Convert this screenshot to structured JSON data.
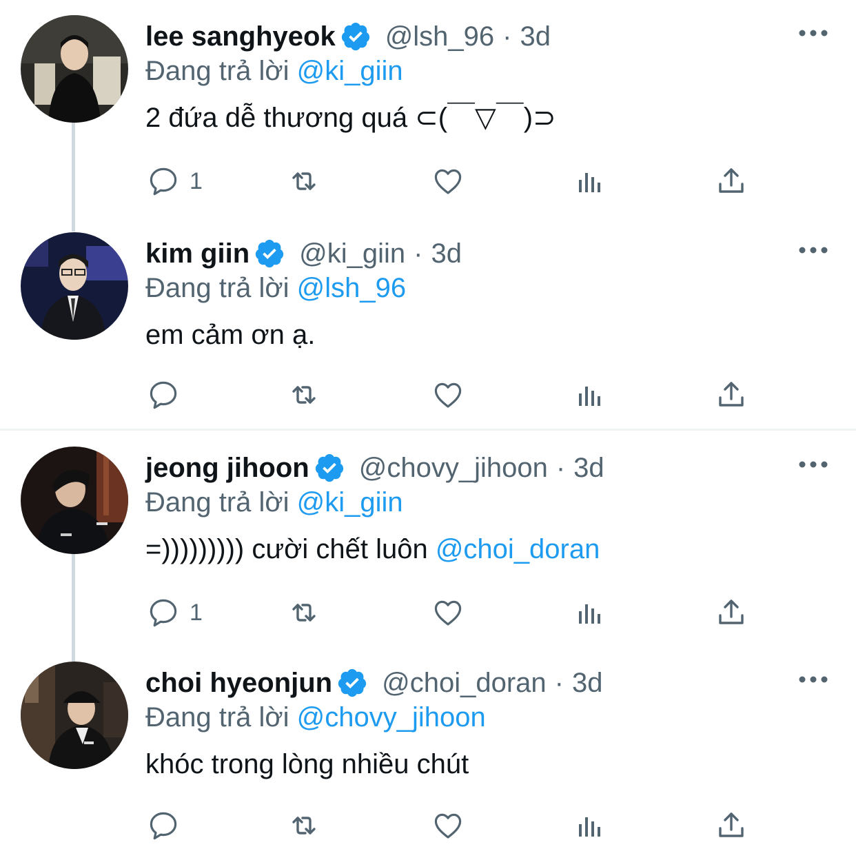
{
  "tweets": [
    {
      "name": "lee sanghyeok",
      "handle": "@lsh_96",
      "dot": "·",
      "time": "3d",
      "replying_prefix": "Đang trả lời",
      "replying_to": "@ki_giin",
      "text": "2 đứa dễ thương quá ⊂(￣▽￣)⊃",
      "mention": "",
      "reply_count": "1"
    },
    {
      "name": "kim giin",
      "handle": "@ki_giin",
      "dot": "·",
      "time": "3d",
      "replying_prefix": "Đang trả lời",
      "replying_to": "@lsh_96",
      "text": "em cảm ơn ạ.",
      "mention": "",
      "reply_count": ""
    },
    {
      "name": "jeong jihoon",
      "handle": "@chovy_jihoon",
      "dot": "·",
      "time": "3d",
      "replying_prefix": "Đang trả lời",
      "replying_to": "@ki_giin",
      "text": "=))))))))) cười chết luôn ",
      "mention": "@choi_doran",
      "reply_count": "1"
    },
    {
      "name": "choi hyeonjun",
      "handle": "@choi_doran",
      "dot": "·",
      "time": "3d",
      "replying_prefix": "Đang trả lời",
      "replying_to": "@chovy_jihoon",
      "text": "khóc trong lòng nhiều chút",
      "mention": "",
      "reply_count": ""
    }
  ],
  "icons": {
    "verified": "verified-badge-icon",
    "more": "more-options-icon",
    "reply": "reply-icon",
    "retweet": "retweet-icon",
    "like": "like-icon",
    "analytics": "analytics-icon",
    "share": "share-icon"
  },
  "colors": {
    "accent": "#1d9bf0",
    "secondary_text": "#536471",
    "icon_gray": "#536471",
    "thread_line": "#cfd9de"
  }
}
